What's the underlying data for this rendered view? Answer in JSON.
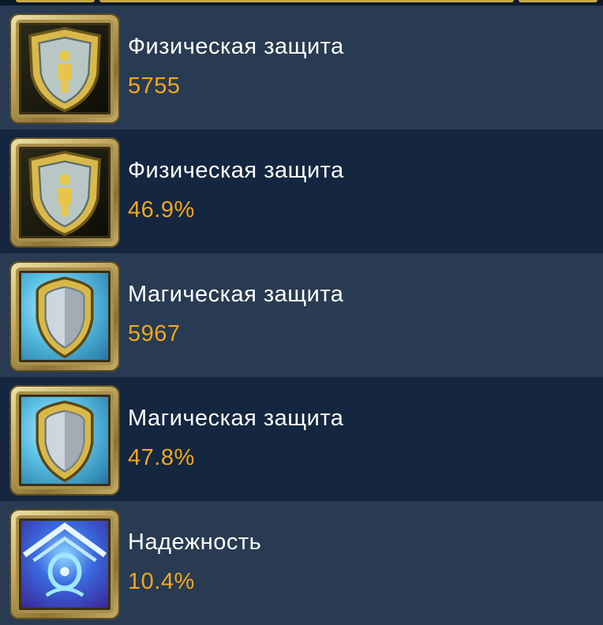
{
  "colors": {
    "row_light": "#283b52",
    "row_dark": "#142640",
    "label_text": "#ffffff",
    "value_text": "#f3a71d",
    "frame_gold": "#c6ad63"
  },
  "stats": [
    {
      "icon": "physical-defense-shield-icon",
      "label": "Физическая защита",
      "value": "5755"
    },
    {
      "icon": "physical-defense-shield-icon",
      "label": "Физическая защита",
      "value": "46.9%"
    },
    {
      "icon": "magic-defense-shield-icon",
      "label": "Магическая защита",
      "value": "5967"
    },
    {
      "icon": "magic-defense-shield-icon",
      "label": "Магическая защита",
      "value": "47.8%"
    },
    {
      "icon": "reliability-rune-icon",
      "label": "Надежность",
      "value": "10.4%"
    }
  ]
}
